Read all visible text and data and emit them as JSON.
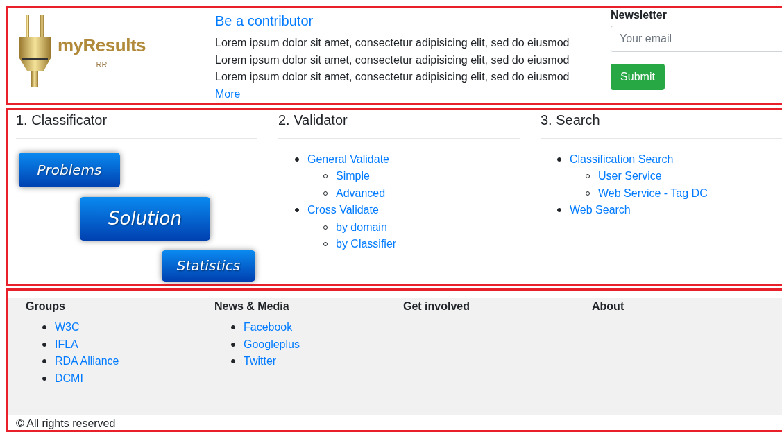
{
  "header": {
    "logo": {
      "name": "myResults",
      "sub": "RR"
    },
    "contributor": {
      "title": "Be a contributor",
      "lines": [
        "Lorem ipsum dolor sit amet, consectetur adipisicing elit, sed do eiusmod",
        "Lorem ipsum dolor sit amet, consectetur adipisicing elit, sed do eiusmod",
        "Lorem ipsum dolor sit amet, consectetur adipisicing elit, sed do eiusmod"
      ],
      "more": "More"
    },
    "newsletter": {
      "title": "Newsletter",
      "placeholder": "Your email",
      "button": "Submit"
    }
  },
  "sections": [
    {
      "title": "1. Classificator",
      "kind": "images",
      "buttons": [
        "Problems",
        "Solution",
        "Statistics"
      ]
    },
    {
      "title": "2. Validator",
      "kind": "list",
      "items": [
        {
          "label": "General Validate",
          "children": [
            {
              "label": "Simple"
            },
            {
              "label": "Advanced"
            }
          ]
        },
        {
          "label": "Cross Validate",
          "children": [
            {
              "label": "by domain"
            },
            {
              "label": "by Classifier"
            }
          ]
        }
      ]
    },
    {
      "title": "3. Search",
      "kind": "list",
      "items": [
        {
          "label": "Classification Search",
          "children": [
            {
              "label": "User Service"
            },
            {
              "label": "Web Service - Tag DC"
            }
          ]
        },
        {
          "label": "Web Search"
        }
      ]
    }
  ],
  "footer": {
    "columns": [
      {
        "title": "Groups",
        "links": [
          "W3C",
          "IFLA",
          "RDA Alliance",
          "DCMI"
        ]
      },
      {
        "title": "News & Media",
        "links": [
          "Facebook",
          "Googleplus",
          "Twitter"
        ]
      },
      {
        "title": "Get involved"
      },
      {
        "title": "About"
      }
    ],
    "copyright": "© All rights reserved"
  }
}
